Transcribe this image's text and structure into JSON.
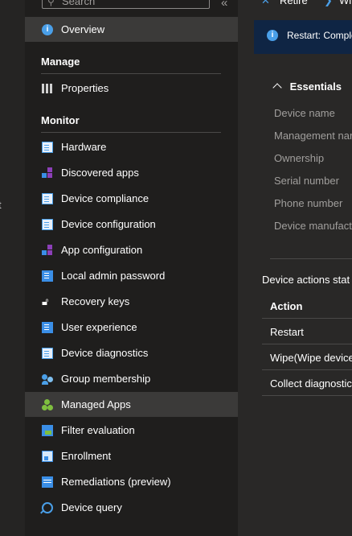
{
  "left_fragment": "t",
  "search": {
    "placeholder": "Search"
  },
  "collapse_glyph": "«",
  "nav": {
    "overview": "Overview",
    "manage_header": "Manage",
    "properties": "Properties",
    "monitor_header": "Monitor",
    "monitor_items": [
      "Hardware",
      "Discovered apps",
      "Device compliance",
      "Device configuration",
      "App configuration",
      "Local admin password",
      "Recovery keys",
      "User experience",
      "Device diagnostics",
      "Group membership",
      "Managed Apps",
      "Filter evaluation",
      "Enrollment",
      "Remediations (preview)",
      "Device query"
    ],
    "selected": "Managed Apps"
  },
  "toolbar": {
    "retire": "Retire",
    "wipe": "Wi"
  },
  "banner": {
    "text": "Restart: Comple"
  },
  "essentials": {
    "title": "Essentials",
    "properties": [
      "Device name",
      "Management nar",
      "Ownership",
      "Serial number",
      "Phone number",
      "Device manufactu"
    ]
  },
  "device_actions": {
    "title": "Device actions stat",
    "header": "Action",
    "rows": [
      "Restart",
      "Wipe(Wipe device",
      "Collect diagnostic"
    ]
  },
  "colors": {
    "accent": "#4a9fe8",
    "selected_bg": "#3b3a39",
    "banner_bg": "#0f2544"
  }
}
